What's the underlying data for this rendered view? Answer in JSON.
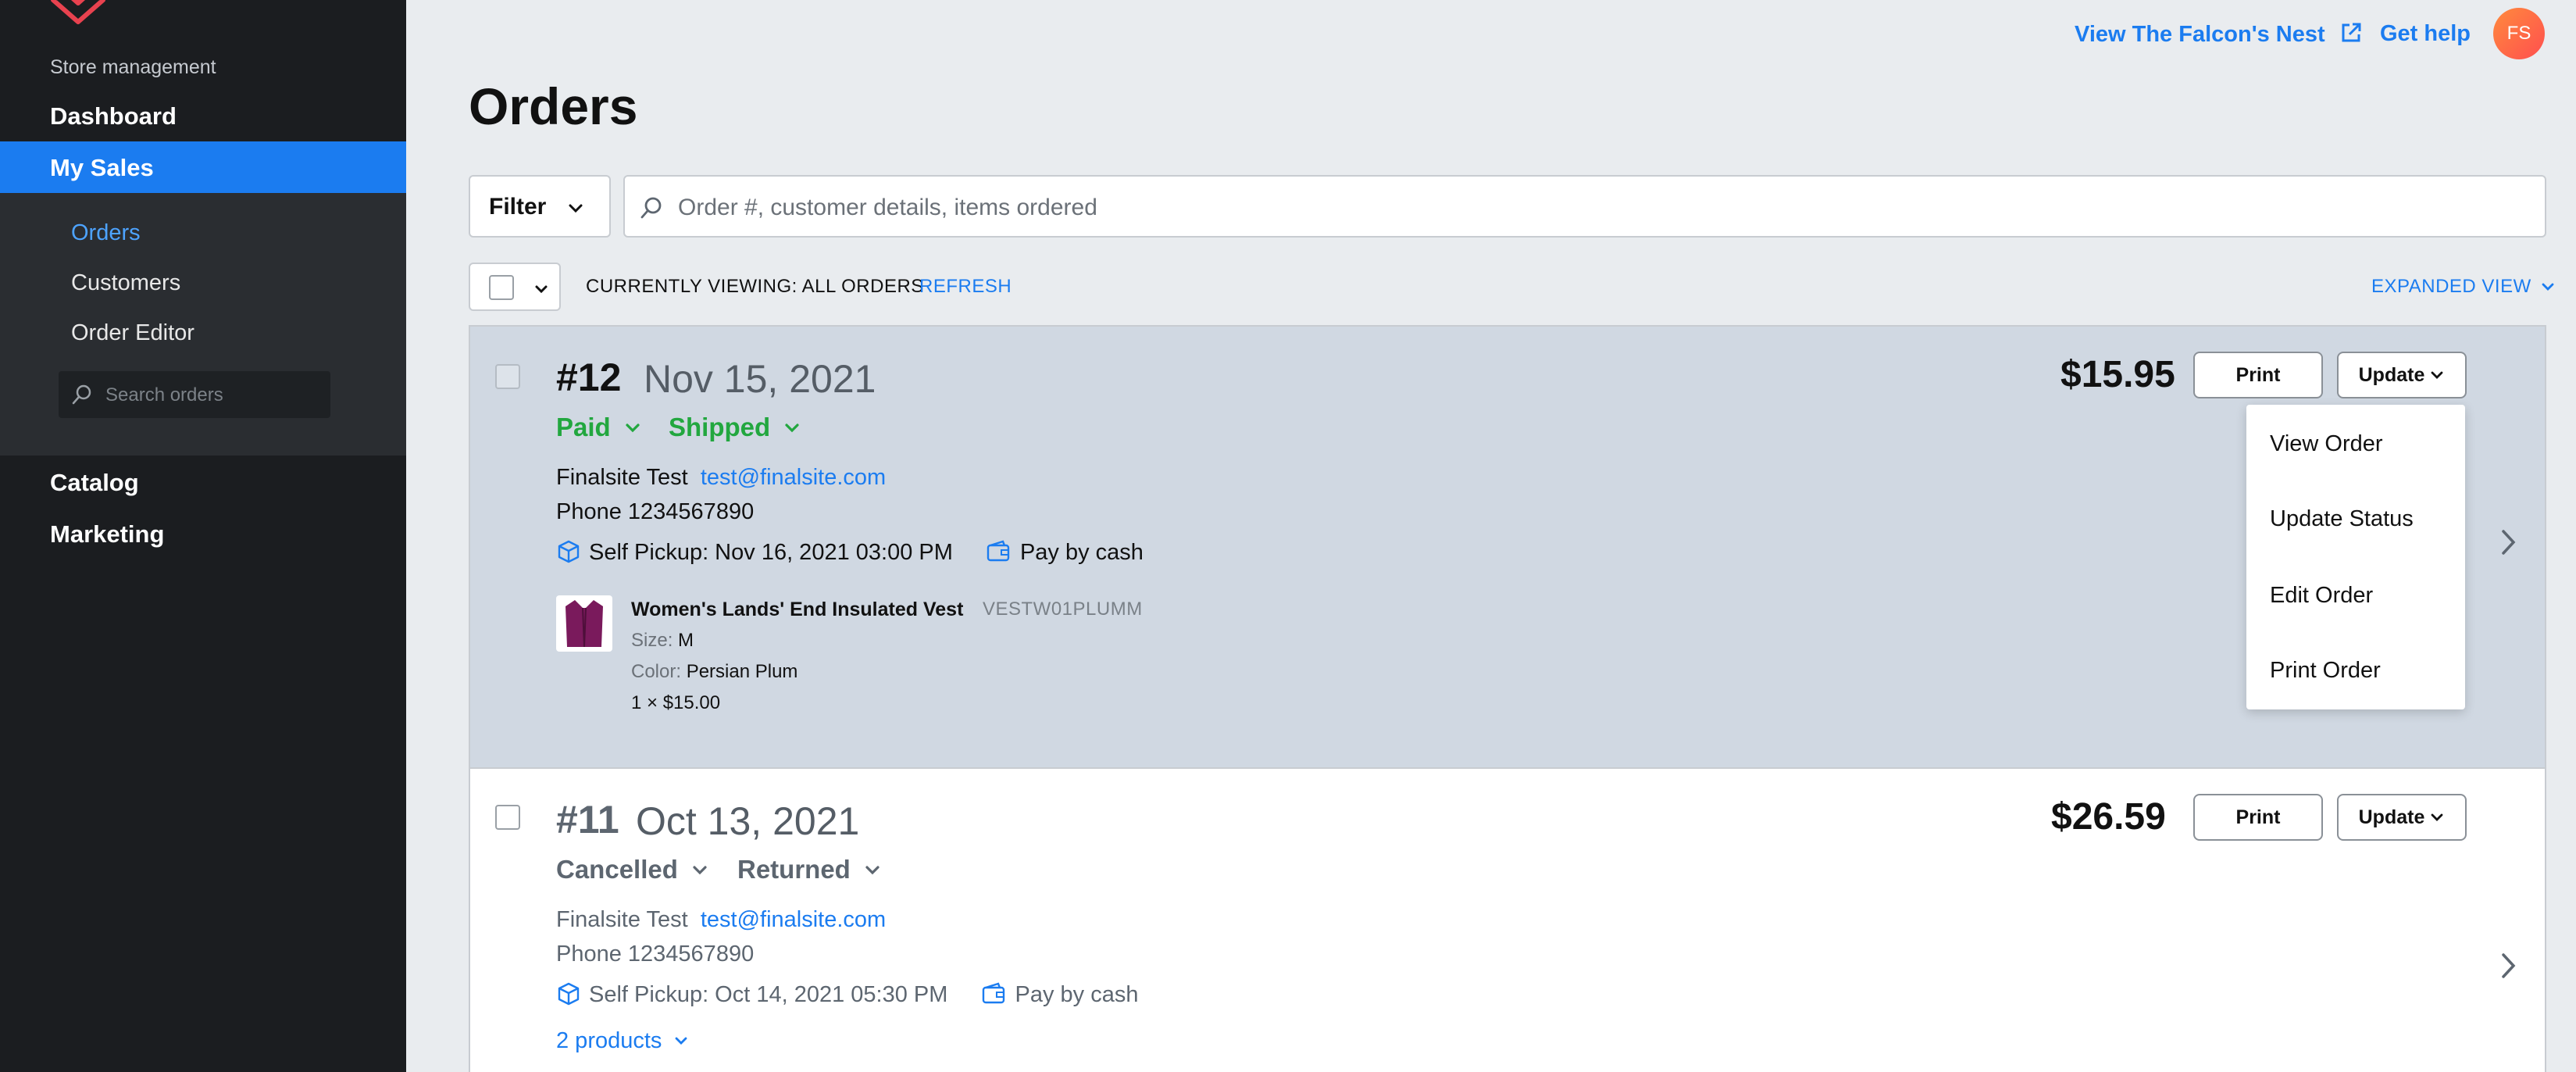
{
  "sidebar": {
    "section_title": "Store management",
    "dashboard": "Dashboard",
    "my_sales": "My Sales",
    "sub_items": [
      "Orders",
      "Customers",
      "Order Editor"
    ],
    "search_placeholder": "Search orders",
    "catalog": "Catalog",
    "marketing": "Marketing"
  },
  "header": {
    "view_store": "View The Falcon's Nest",
    "get_help": "Get help",
    "avatar_initials": "FS"
  },
  "page": {
    "title": "Orders",
    "filter_label": "Filter",
    "search_placeholder": "Order #, customer details, items ordered",
    "viewing": "CURRENTLY VIEWING: ALL ORDERS",
    "refresh": "REFRESH",
    "expanded_view": "EXPANDED VIEW"
  },
  "orders": [
    {
      "number": "#12",
      "date": "Nov 15, 2021",
      "payment_status": "Paid",
      "fulfillment_status": "Shipped",
      "customer": "Finalsite Test",
      "email": "test@finalsite.com",
      "phone": "Phone 1234567890",
      "pickup": "Self Pickup: Nov 16, 2021 03:00 PM",
      "payment": "Pay by cash",
      "price": "$15.95",
      "print_label": "Print",
      "update_label": "Update",
      "item": {
        "name": "Women's Lands' End Insulated Vest",
        "sku": "VESTW01PLUMM",
        "size_label": "Size:",
        "size": "M",
        "color_label": "Color:",
        "color": "Persian Plum",
        "qty_price": "1 × $15.00"
      }
    },
    {
      "number": "#11",
      "date": "Oct 13, 2021",
      "payment_status": "Cancelled",
      "fulfillment_status": "Returned",
      "customer": "Finalsite Test",
      "email": "test@finalsite.com",
      "phone": "Phone 1234567890",
      "pickup": "Self Pickup: Oct 14, 2021 05:30 PM",
      "payment": "Pay by cash",
      "price": "$26.59",
      "print_label": "Print",
      "update_label": "Update",
      "products_link": "2 products"
    }
  ],
  "update_menu": [
    "View Order",
    "Update Status",
    "Edit Order",
    "Print Order"
  ],
  "colors": {
    "accent": "#1b7cf0",
    "paid_green": "#22a73f",
    "sidebar_bg": "#1b1d20",
    "logo_red": "#e8424f"
  }
}
